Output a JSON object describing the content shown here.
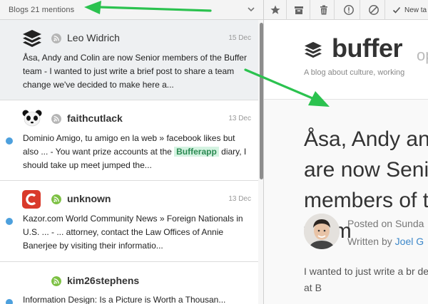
{
  "toolbar": {
    "blogs_label": "Blogs 21 mentions",
    "new_tab_label": "New ta"
  },
  "posts": [
    {
      "author": "Leo Widrich",
      "date": "15 Dec",
      "text": "Åsa, Andy and Colin are now Senior members of the Buffer team - I wanted to just write a brief post to share a team change we've decided to make here a...",
      "avatar": "buffer-stack-icon",
      "feed_color": "#b5b5b5"
    },
    {
      "author": "faithcutlack",
      "date": "13 Dec",
      "text_before": "Dominio Amigo, tu amigo en la web » facebook likes but also ... - You want prize accounts at the ",
      "highlight": "Bufferapp",
      "text_after": " diary, I should take up meet jumped the...",
      "avatar": "panda-icon",
      "feed_color": "#b5b5b5"
    },
    {
      "author": "unknown",
      "date": "13 Dec",
      "text": "Kazor.com World Community News » Foreign Nationals in U.S. ... - ... attorney, contact the Law Offices of Annie Banerjee by visiting their informatio...",
      "avatar": "c-logo-icon",
      "feed_color": "#7cc043"
    },
    {
      "author": "kim26stephens",
      "date": "",
      "text": "Information Design: Is a Picture is Worth a Thousan...",
      "avatar": "",
      "feed_color": "#7cc043"
    }
  ],
  "reader": {
    "brand": "buffer",
    "brand_suffix": "op",
    "tagline": "A blog about culture, working",
    "title": "Åsa, Andy and Colin are now Senior members of the Buffer team",
    "posted": "Posted on Sunda",
    "written_prefix": "Written by ",
    "written_author": "Joel G",
    "excerpt": "I wanted to just write a br decided to make here at B"
  },
  "colors": {
    "accent_arrow": "#2bc24f",
    "unread_dot": "#4da0dd",
    "link": "#3b87c9"
  }
}
